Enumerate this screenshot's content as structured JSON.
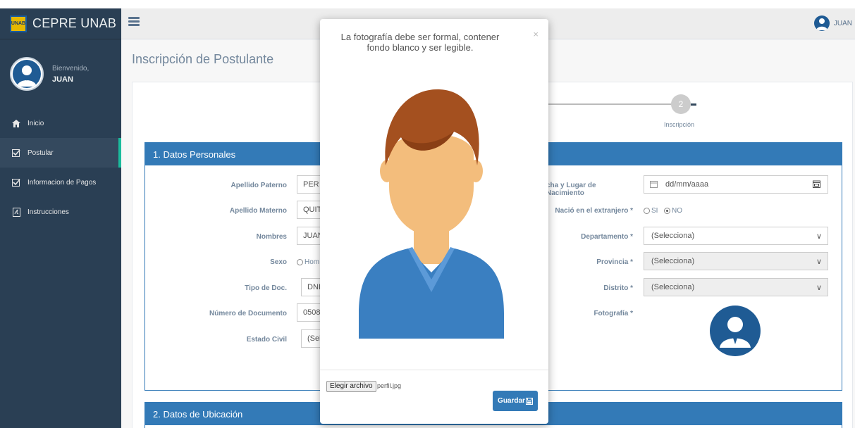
{
  "brand": {
    "title": "CEPRE UNAB",
    "logo_text": "UNAB"
  },
  "sidebar": {
    "welcome": "Bienvenido,",
    "user": "JUAN",
    "items": [
      {
        "label": "Inicio",
        "icon": "home-icon"
      },
      {
        "label": "Postular",
        "icon": "checkbox-icon"
      },
      {
        "label": "Informacion de Pagos",
        "icon": "checkbox-icon"
      },
      {
        "label": "Instrucciones",
        "icon": "pdf-icon"
      }
    ]
  },
  "topbar": {
    "user": "JUAN"
  },
  "page": {
    "title": "Inscripción de Postulante",
    "wizard": {
      "step_number": "2",
      "step_label": "Inscripción"
    }
  },
  "section1": {
    "title": "1. Datos Personales",
    "left": {
      "apellido_paterno": {
        "label": "Apellido Paterno",
        "value": "PER"
      },
      "apellido_materno": {
        "label": "Apellido Materno",
        "value": "QUIT"
      },
      "nombres": {
        "label": "Nombres",
        "value": "JUAN"
      },
      "sexo": {
        "label": "Sexo",
        "option": "Hom"
      },
      "tipo_doc": {
        "label": "Tipo de Doc.",
        "value": "DNI"
      },
      "numero_doc": {
        "label": "Número de Documento",
        "value": "0508"
      },
      "estado_civil": {
        "label": "Estado Civil",
        "value": "(Sel"
      }
    },
    "right": {
      "nacimiento": {
        "label": "cha y Lugar de Nacimiento",
        "placeholder": "dd/mm/aaaa"
      },
      "extranjero": {
        "label": "Nació en el extranjero *",
        "opt_si": "SI",
        "opt_no": "NO"
      },
      "departamento": {
        "label": "Departamento *",
        "value": "(Selecciona)"
      },
      "provincia": {
        "label": "Provincia *",
        "value": "(Selecciona)"
      },
      "distrito": {
        "label": "Distrito *",
        "value": "(Selecciona)"
      },
      "fotografia": {
        "label": "Fotografía *"
      }
    }
  },
  "section2": {
    "title": "2. Datos de Ubicación"
  },
  "modal": {
    "title": "La fotografía debe ser formal, contener fondo blanco y ser legible.",
    "close": "×",
    "file_button": "Elegir archivo",
    "file_name": "perfil.jpg",
    "save_label": "Guardar"
  },
  "colors": {
    "sidebar": "#2a3f54",
    "primary": "#337ab7",
    "hair": "#a4501f",
    "skin": "#f3bd7c",
    "shirt": "#3a7fc1"
  }
}
